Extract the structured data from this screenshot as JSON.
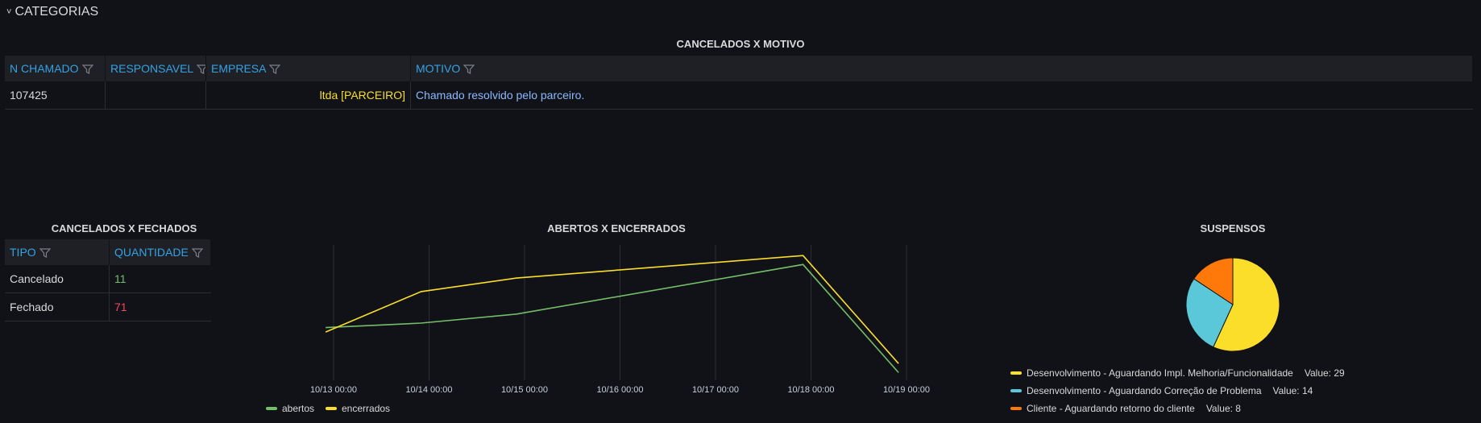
{
  "row": {
    "title": "CATEGORIAS"
  },
  "cancelados_motivo": {
    "title": "CANCELADOS X MOTIVO",
    "headers": [
      "N CHAMADO",
      "RESPONSAVEL",
      "EMPRESA",
      "MOTIVO"
    ],
    "rows": [
      {
        "n_chamado": "107425",
        "responsavel": "",
        "empresa": "ltda [PARCEIRO]",
        "motivo": "Chamado resolvido pelo parceiro."
      }
    ]
  },
  "cancelados_fechados": {
    "title": "CANCELADOS X FECHADOS",
    "headers": [
      "TIPO",
      "QUANTIDADE"
    ],
    "rows": [
      {
        "tipo": "Cancelado",
        "quantidade": "11"
      },
      {
        "tipo": "Fechado",
        "quantidade": "71"
      }
    ]
  },
  "colors": {
    "abertos": "#73bf69",
    "encerrados": "#fade2a",
    "quant_green": "#73bf69",
    "quant_red": "#f2495c",
    "empresa": "#fade2a",
    "motivo": "#8ab8ff"
  },
  "chart_data": [
    {
      "type": "line",
      "title": "ABERTOS X ENCERRADOS",
      "x_ticks": [
        "10/13 00:00",
        "10/14 00:00",
        "10/15 00:00",
        "10/16 00:00",
        "10/17 00:00",
        "10/18 00:00",
        "10/19 00:00"
      ],
      "x": [
        "10/12 22:00",
        "10/13 22:00",
        "10/14 22:00",
        "10/17 22:00",
        "10/18 22:00"
      ],
      "series": [
        {
          "name": "abertos",
          "values": [
            10,
            12,
            16,
            38,
            -10
          ]
        },
        {
          "name": "encerrados",
          "values": [
            8,
            26,
            32,
            42,
            -6
          ]
        }
      ],
      "ylim": [
        -12,
        46
      ],
      "grid": true,
      "legend": "bottom-left"
    },
    {
      "type": "pie",
      "title": "SUSPENSOS",
      "slices": [
        {
          "name": "Desenvolvimento - Aguardando Impl. Melhoria/Funcionalidade",
          "value": 29,
          "color": "#fade2a",
          "value_label": "Value: 29"
        },
        {
          "name": "Desenvolvimento - Aguardando Correção de Problema",
          "value": 14,
          "color": "#5ac8d8",
          "value_label": "Value: 14"
        },
        {
          "name": "Cliente - Aguardando retorno do cliente",
          "value": 8,
          "color": "#ff780a",
          "value_label": "Value: 8"
        }
      ],
      "legend": "bottom"
    }
  ]
}
